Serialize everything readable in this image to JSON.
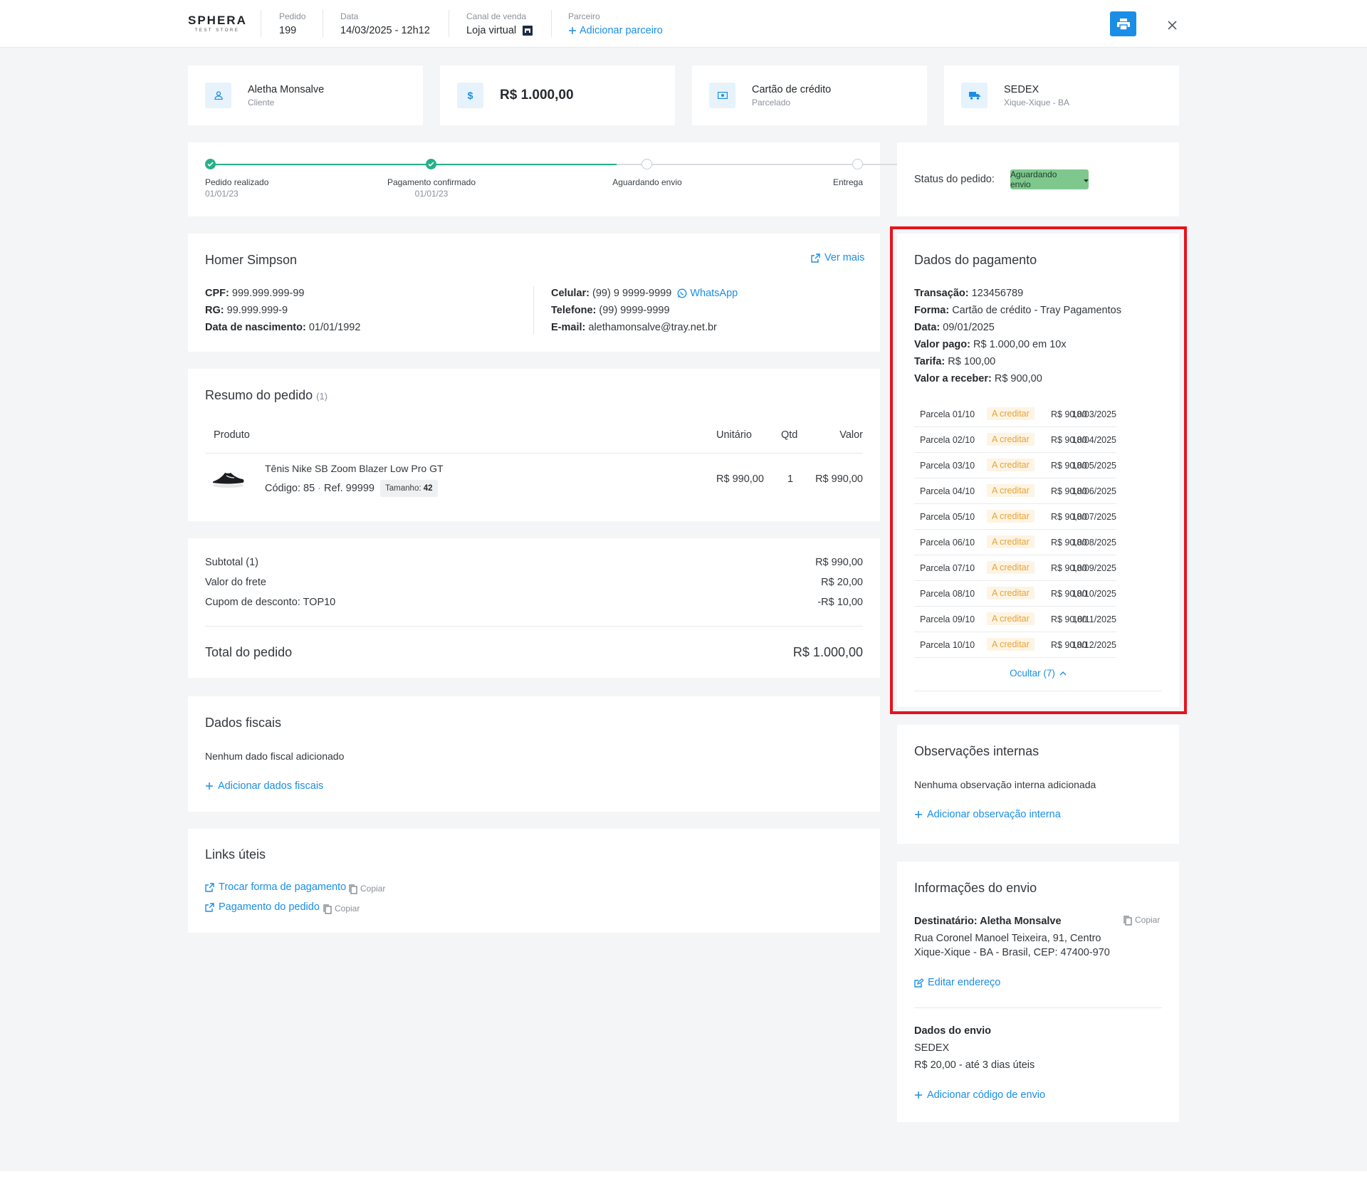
{
  "header": {
    "logo_main": "SPHERA",
    "logo_sub": "TEST STORE",
    "order_label": "Pedido",
    "order_value": "199",
    "date_label": "Data",
    "date_value": "14/03/2025 - 12h12",
    "channel_label": "Canal de venda",
    "channel_value": "Loja virtual",
    "partner_label": "Parceiro",
    "partner_action": "Adicionar parceiro"
  },
  "summary": {
    "customer_name": "Aletha Monsalve",
    "customer_sub": "Cliente",
    "total": "R$ 1.000,00",
    "payment_method": "Cartão de crédito",
    "payment_sub": "Parcelado",
    "shipping_method": "SEDEX",
    "shipping_sub": "Xique-Xique - BA"
  },
  "progress": {
    "steps": [
      {
        "label": "Pedido realizado",
        "date": "01/01/23"
      },
      {
        "label": "Pagamento confirmado",
        "date": "01/01/23"
      },
      {
        "label": "Aguardando envio",
        "date": ""
      },
      {
        "label": "Entrega",
        "date": ""
      }
    ]
  },
  "status": {
    "label": "Status do pedido:",
    "value": "Aguardando envio"
  },
  "customer": {
    "title": "Homer Simpson",
    "see_more": "Ver mais",
    "cpf_label": "CPF:",
    "cpf": "999.999.999-99",
    "rg_label": "RG:",
    "rg": "99.999.999-9",
    "birth_label": "Data de nascimento:",
    "birth": "01/01/1992",
    "mobile_label": "Celular:",
    "mobile": "(99) 9 9999-9999",
    "whatsapp": "WhatsApp",
    "phone_label": "Telefone:",
    "phone": "(99) 9999-9999",
    "email_label": "E-mail:",
    "email": "alethamonsalve@tray.net.br"
  },
  "order_summary": {
    "title": "Resumo do pedido",
    "count": "(1)",
    "columns": {
      "product": "Produto",
      "unit": "Unitário",
      "qty": "Qtd",
      "value": "Valor"
    },
    "item": {
      "name": "Tênis Nike SB Zoom Blazer Low Pro GT",
      "code": "Código: 85",
      "sep": "·",
      "ref": "Ref. 99999",
      "size_label": "Tamanho:",
      "size": "42",
      "unit": "R$ 990,00",
      "qty": "1",
      "value": "R$ 990,00"
    }
  },
  "totals": {
    "subtotal_label": "Subtotal (1)",
    "subtotal": "R$ 990,00",
    "shipping_label": "Valor do frete",
    "shipping": "R$ 20,00",
    "coupon_label": "Cupom de desconto: TOP10",
    "coupon": "-R$ 10,00",
    "total_label": "Total do pedido",
    "total": "R$ 1.000,00"
  },
  "fiscal": {
    "title": "Dados fiscais",
    "empty": "Nenhum dado fiscal adicionado",
    "action": "Adicionar dados fiscais"
  },
  "links": {
    "title": "Links úteis",
    "items": [
      {
        "label": "Trocar forma de pagamento",
        "copy": "Copiar"
      },
      {
        "label": "Pagamento do pedido",
        "copy": "Copiar"
      }
    ]
  },
  "payment": {
    "title": "Dados do pagamento",
    "transaction_label": "Transação:",
    "transaction": "123456789",
    "method_label": "Forma:",
    "method": "Cartão de crédito - Tray Pagamentos",
    "date_label": "Data:",
    "date": "09/01/2025",
    "paid_label": "Valor pago:",
    "paid": "R$ 1.000,00 em 10x",
    "fee_label": "Tarifa:",
    "fee": "R$ 100,00",
    "receive_label": "Valor a receber:",
    "receive": "R$ 900,00",
    "installments": [
      {
        "label": "Parcela 01/10",
        "status": "A creditar",
        "value": "R$ 90,00",
        "date": "18/03/2025"
      },
      {
        "label": "Parcela  02/10",
        "status": "A creditar",
        "value": "R$ 90,00",
        "date": "18/04/2025"
      },
      {
        "label": "Parcela  03/10",
        "status": "A creditar",
        "value": "R$ 90,00",
        "date": "18/05/2025"
      },
      {
        "label": "Parcela  04/10",
        "status": "A creditar",
        "value": "R$ 90,00",
        "date": "18/06/2025"
      },
      {
        "label": "Parcela  05/10",
        "status": "A creditar",
        "value": "R$ 90,00",
        "date": "18/07/2025"
      },
      {
        "label": "Parcela  06/10",
        "status": "A creditar",
        "value": "R$ 90,00",
        "date": "18/08/2025"
      },
      {
        "label": "Parcela  07/10",
        "status": "A creditar",
        "value": "R$ 90,00",
        "date": "18/09/2025"
      },
      {
        "label": "Parcela  08/10",
        "status": "A creditar",
        "value": "R$ 90,00",
        "date": "18/10/2025"
      },
      {
        "label": "Parcela  09/10",
        "status": "A creditar",
        "value": "R$ 90,00",
        "date": "18/11/2025"
      },
      {
        "label": "Parcela  10/10",
        "status": "A creditar",
        "value": "R$ 90,00",
        "date": "18/12/2025"
      }
    ],
    "hide_label": "Ocultar (7)"
  },
  "notes": {
    "title": "Observações internas",
    "empty": "Nenhuma observação interna adicionada",
    "action": "Adicionar observação interna"
  },
  "shipping_info": {
    "title": "Informações do envio",
    "recipient": "Destinatário: Aletha Monsalve",
    "copy": "Copiar",
    "address1": "Rua Coronel Manoel Teixeira, 91, Centro",
    "address2": "Xique-Xique - BA - Brasil, CEP: 47400-970",
    "edit_address": "Editar endereço",
    "shipping_title": "Dados do envio",
    "carrier": "SEDEX",
    "price_eta": "R$ 20,00 - até 3 dias úteis",
    "add_tracking": "Adicionar código de envio"
  },
  "colors": {
    "accent": "#1a8ee6",
    "success": "#25b08a",
    "status_badge": "#7ec88e",
    "pending_text": "#e8a33a",
    "highlight": "#e8121a"
  }
}
